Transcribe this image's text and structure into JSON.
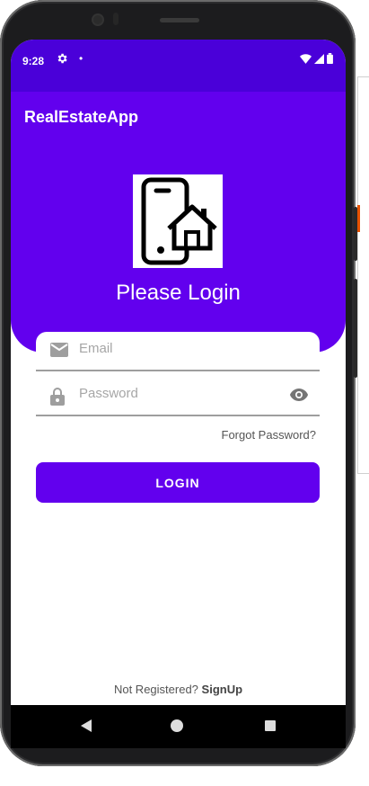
{
  "status_bar": {
    "time": "9:28",
    "settings_icon": "gear-icon",
    "notification_dot": "•",
    "icons": [
      "wifi-icon",
      "signal-icon",
      "battery-icon"
    ]
  },
  "app_bar": {
    "title": "RealEstateApp"
  },
  "header": {
    "logo_icon": "phone-home-icon",
    "heading": "Please Login"
  },
  "form": {
    "email": {
      "placeholder": "Email",
      "value": "",
      "icon": "email-icon"
    },
    "password": {
      "placeholder": "Password",
      "value": "",
      "icon": "lock-icon",
      "toggle_icon": "eye-icon"
    },
    "forgot_label": "Forgot Password?",
    "login_label": "LOGIN"
  },
  "footer": {
    "prompt": "Not Registered? ",
    "signup_label": "SignUp"
  },
  "colors": {
    "status_bar": "#4a00d9",
    "primary": "#6200ee",
    "text_muted": "#555555"
  },
  "nav": {
    "icons": [
      "back-icon",
      "home-icon",
      "recents-icon"
    ]
  }
}
